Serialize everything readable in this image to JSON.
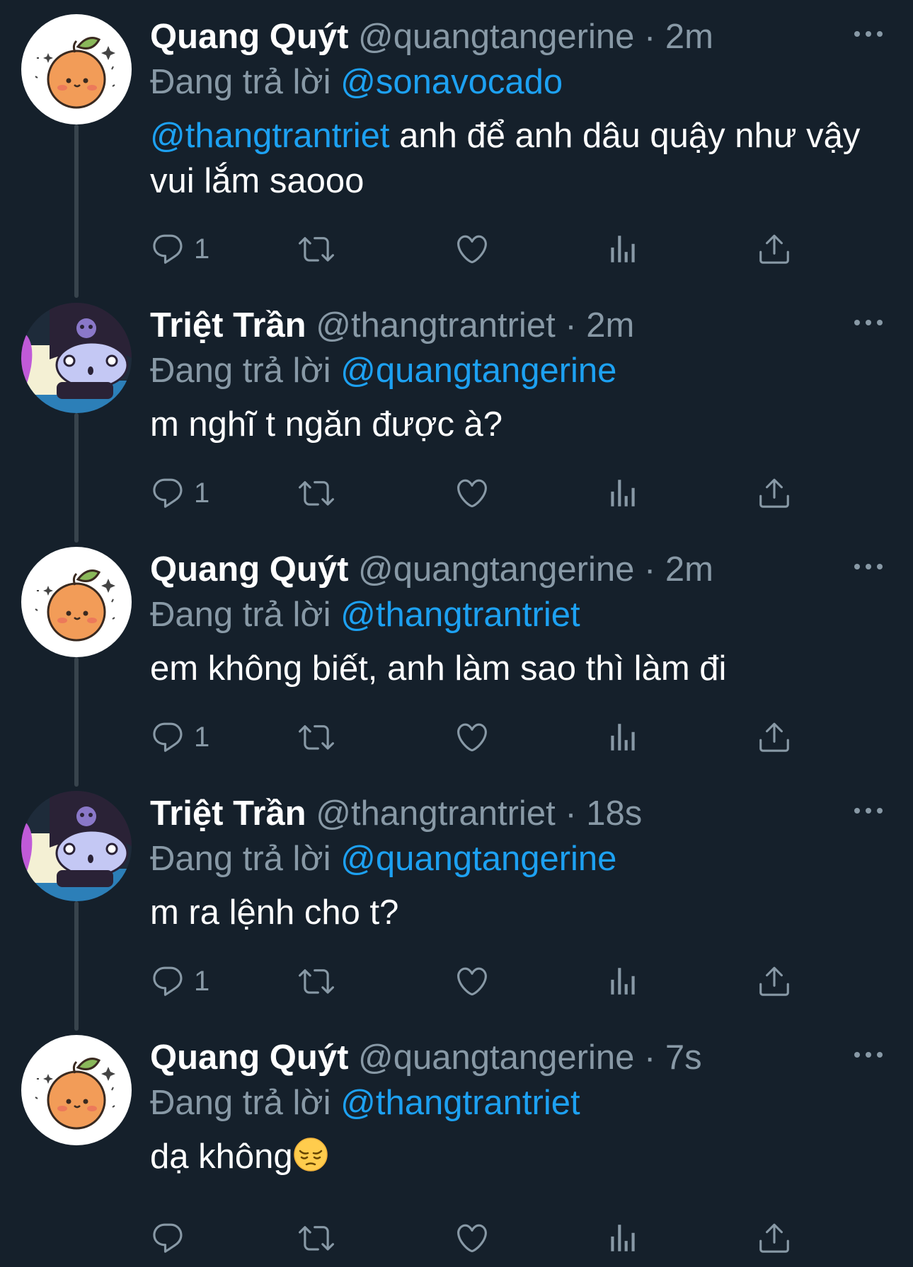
{
  "colors": {
    "background": "#15202b",
    "text_primary": "#ffffff",
    "text_secondary": "#8899a6",
    "mention": "#1da1f2",
    "thread_line": "#38444d"
  },
  "reply_prefix": "Đang trả lời",
  "tweets": [
    {
      "name": "Quang Quýt",
      "handle": "@quangtangerine",
      "separator": "·",
      "time": "2m",
      "reply_to": "@sonavocado",
      "mention": "@thangtrantriet",
      "text": "anh để anh dâu quậy như vậy vui lắm saooo",
      "reply_count": "1",
      "avatar_icon": "orange-avatar-icon"
    },
    {
      "name": "Triệt Trần",
      "handle": "@thangtrantriet",
      "separator": "·",
      "time": "2m",
      "reply_to": "@quangtangerine",
      "text": "m nghĩ t ngăn được à?",
      "reply_count": "1",
      "avatar_icon": "kuromi-avatar-icon"
    },
    {
      "name": "Quang Quýt",
      "handle": "@quangtangerine",
      "separator": "·",
      "time": "2m",
      "reply_to": "@thangtrantriet",
      "text": "em không biết, anh làm sao thì làm đi",
      "reply_count": "1",
      "avatar_icon": "orange-avatar-icon"
    },
    {
      "name": "Triệt Trần",
      "handle": "@thangtrantriet",
      "separator": "·",
      "time": "18s",
      "reply_to": "@quangtangerine",
      "text": "m ra lệnh cho t?",
      "reply_count": "1",
      "avatar_icon": "kuromi-avatar-icon"
    },
    {
      "name": "Quang Quýt",
      "handle": "@quangtangerine",
      "separator": "·",
      "time": "7s",
      "reply_to": "@thangtrantriet",
      "text": "dạ không",
      "reply_count": "",
      "avatar_icon": "orange-avatar-icon"
    }
  ]
}
